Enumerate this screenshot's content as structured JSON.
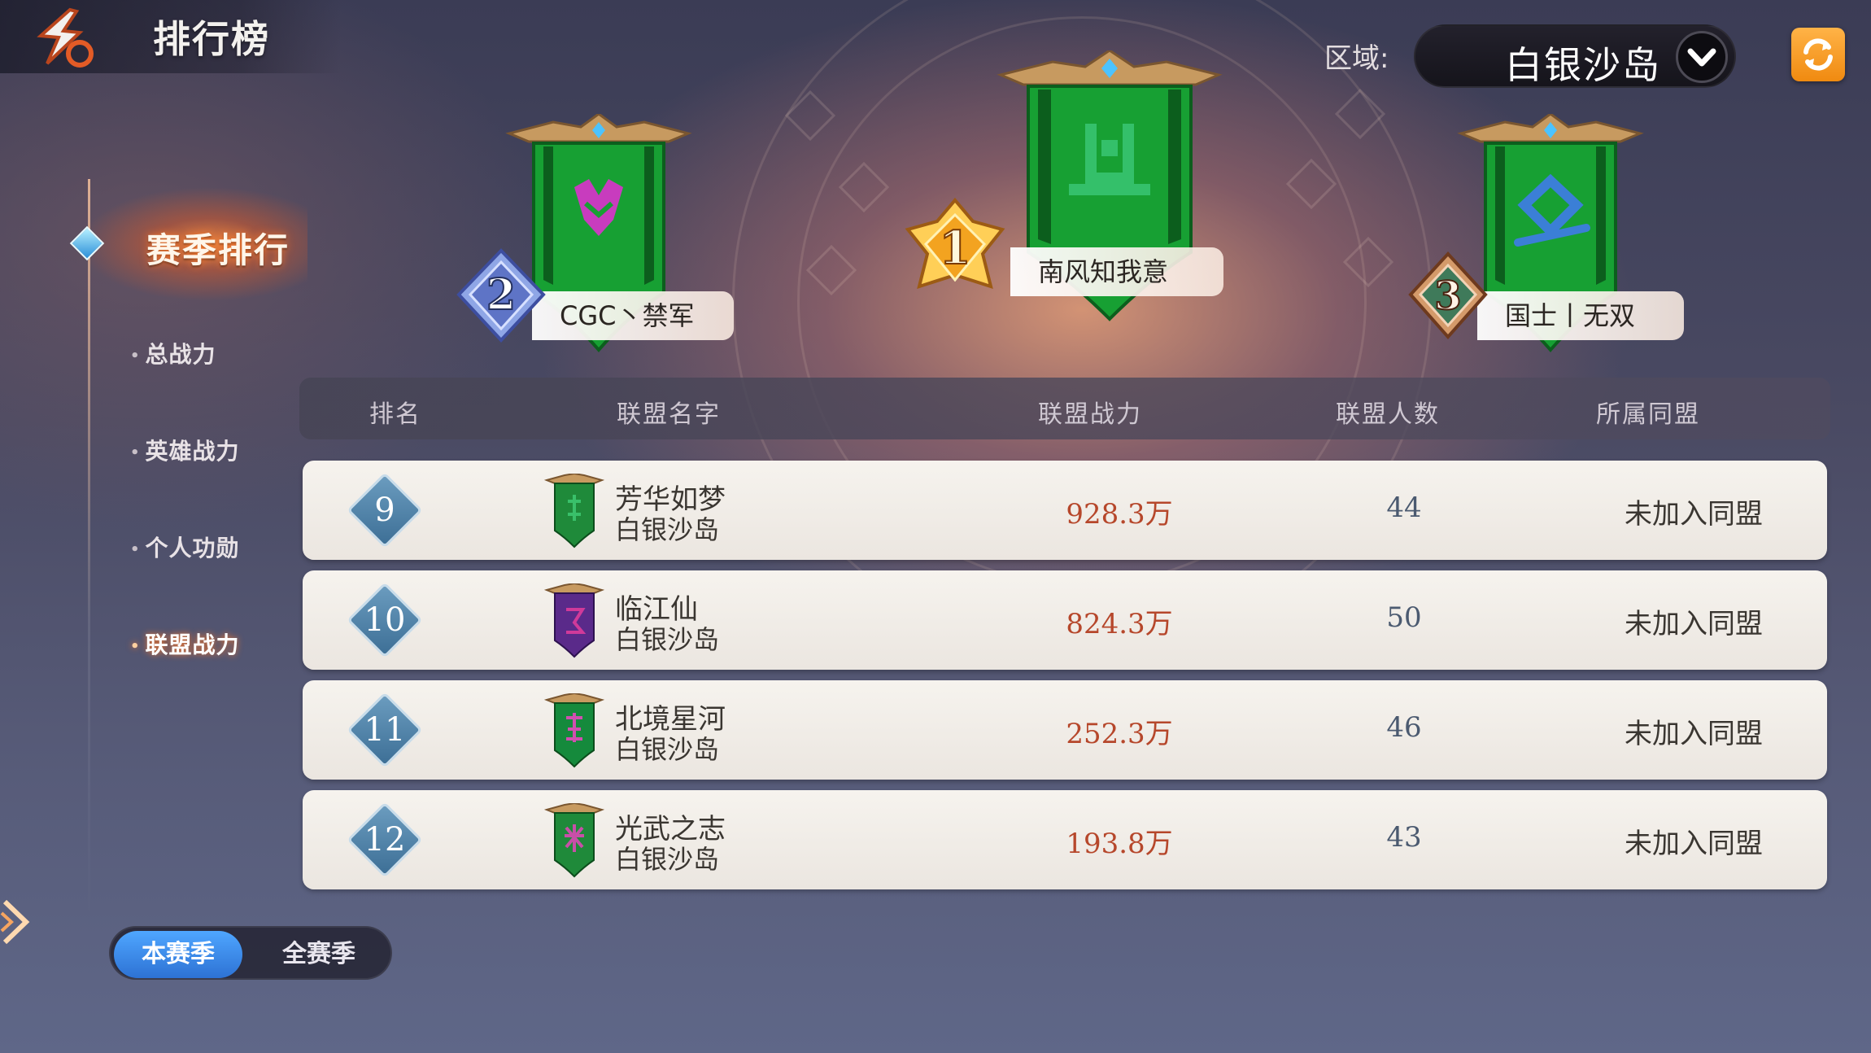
{
  "header": {
    "title": "排行榜"
  },
  "region": {
    "label": "区域:",
    "value": "白银沙岛"
  },
  "nav": {
    "active_section": "赛季排行",
    "items": [
      {
        "label": "总战力",
        "selected": false
      },
      {
        "label": "英雄战力",
        "selected": false
      },
      {
        "label": "个人功勋",
        "selected": false
      },
      {
        "label": "联盟战力",
        "selected": true
      }
    ]
  },
  "season_toggle": {
    "current": "本赛季",
    "all": "全赛季"
  },
  "podium": [
    {
      "rank": "1",
      "name": "南风知我意",
      "flag_color": "#17a033",
      "emblem_color": "#34c06a"
    },
    {
      "rank": "2",
      "name": "CGC丶禁军",
      "flag_color": "#17a033",
      "emblem_color": "#c83cbe"
    },
    {
      "rank": "3",
      "name": "国士丨无双",
      "flag_color": "#17a033",
      "emblem_color": "#3b7fd6"
    }
  ],
  "table": {
    "headers": {
      "rank": "排名",
      "name": "联盟名字",
      "power": "联盟战力",
      "members": "联盟人数",
      "alliance": "所属同盟"
    },
    "rows": [
      {
        "rank": "9",
        "name": "芳华如梦",
        "server": "白银沙岛",
        "power": "928.3万",
        "members": "44",
        "alliance": "未加入同盟",
        "flag_color": "#1f8a3a"
      },
      {
        "rank": "10",
        "name": "临江仙",
        "server": "白银沙岛",
        "power": "824.3万",
        "members": "50",
        "alliance": "未加入同盟",
        "flag_color": "#5a2a8a"
      },
      {
        "rank": "11",
        "name": "北境星河",
        "server": "白银沙岛",
        "power": "252.3万",
        "members": "46",
        "alliance": "未加入同盟",
        "flag_color": "#158a3c"
      },
      {
        "rank": "12",
        "name": "光武之志",
        "server": "白银沙岛",
        "power": "193.8万",
        "members": "43",
        "alliance": "未加入同盟",
        "flag_color": "#1f8a3a"
      }
    ]
  },
  "colors": {
    "accent_orange": "#f08a10",
    "active_blue": "#2d72d4",
    "power_red": "#b6472b"
  }
}
